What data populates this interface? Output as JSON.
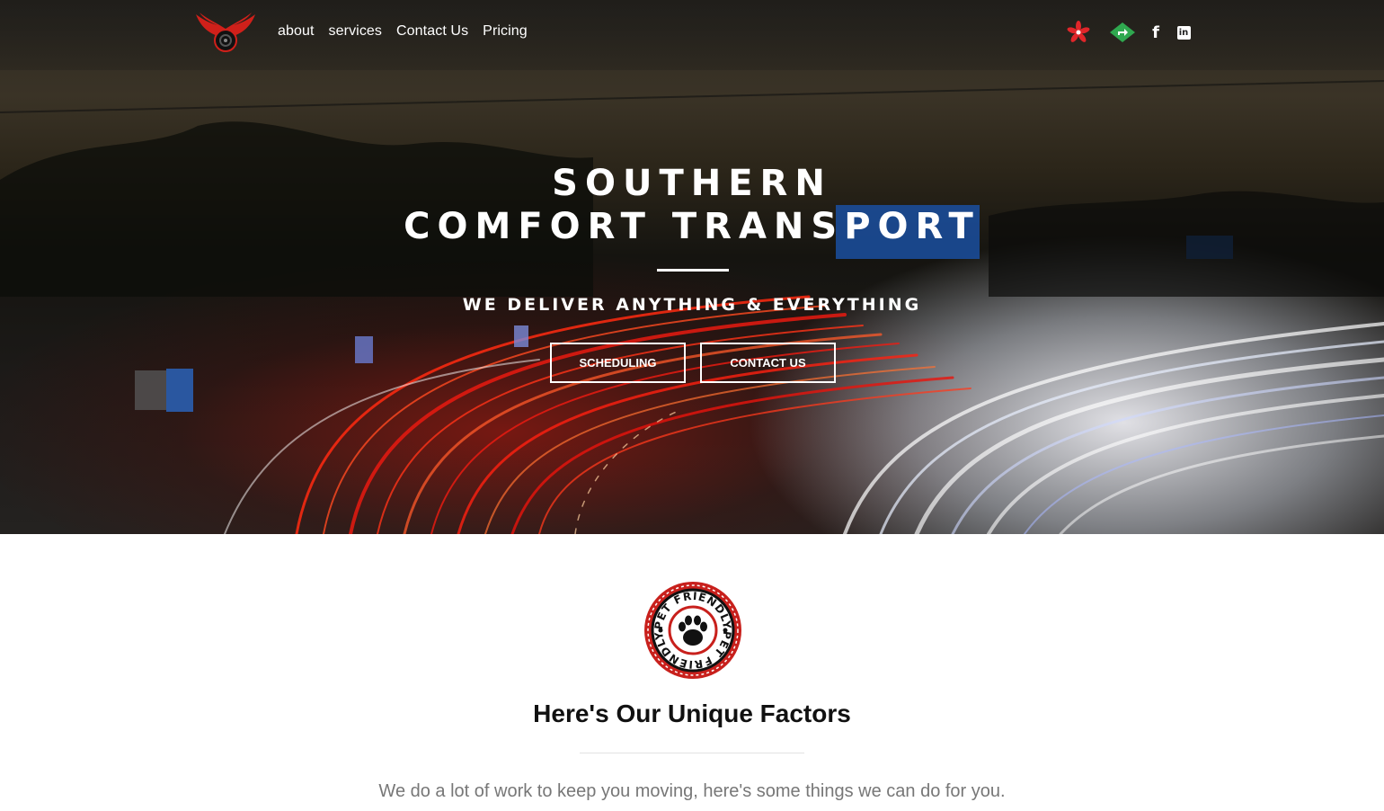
{
  "header": {
    "logo_name": "winged-wheel-logo",
    "nav": [
      {
        "label": "about"
      },
      {
        "label": "services"
      },
      {
        "label": "Contact Us"
      },
      {
        "label": "Pricing"
      }
    ],
    "socials": [
      {
        "icon": "yelp-icon"
      },
      {
        "icon": "route-icon"
      },
      {
        "icon": "facebook-icon",
        "glyph": "f"
      },
      {
        "icon": "linkedin-icon",
        "glyph": "in"
      }
    ]
  },
  "hero": {
    "title_line1": "SOUTHERN",
    "title_line2": "COMFORT TRANSPORT",
    "tagline": "WE DELIVER ANYTHING & EVERYTHING",
    "buttons": {
      "scheduling": "SCHEDULING",
      "contact": "CONTACT US"
    }
  },
  "features": {
    "badge_text": "PET FRIENDLY",
    "title": "Here's Our Unique Factors",
    "subtitle": "We do a lot of work to keep you moving, here's some things we can do for you."
  },
  "colors": {
    "accent_red": "#d0201a",
    "text_white": "#ffffff",
    "subtitle_gray": "#777777"
  }
}
